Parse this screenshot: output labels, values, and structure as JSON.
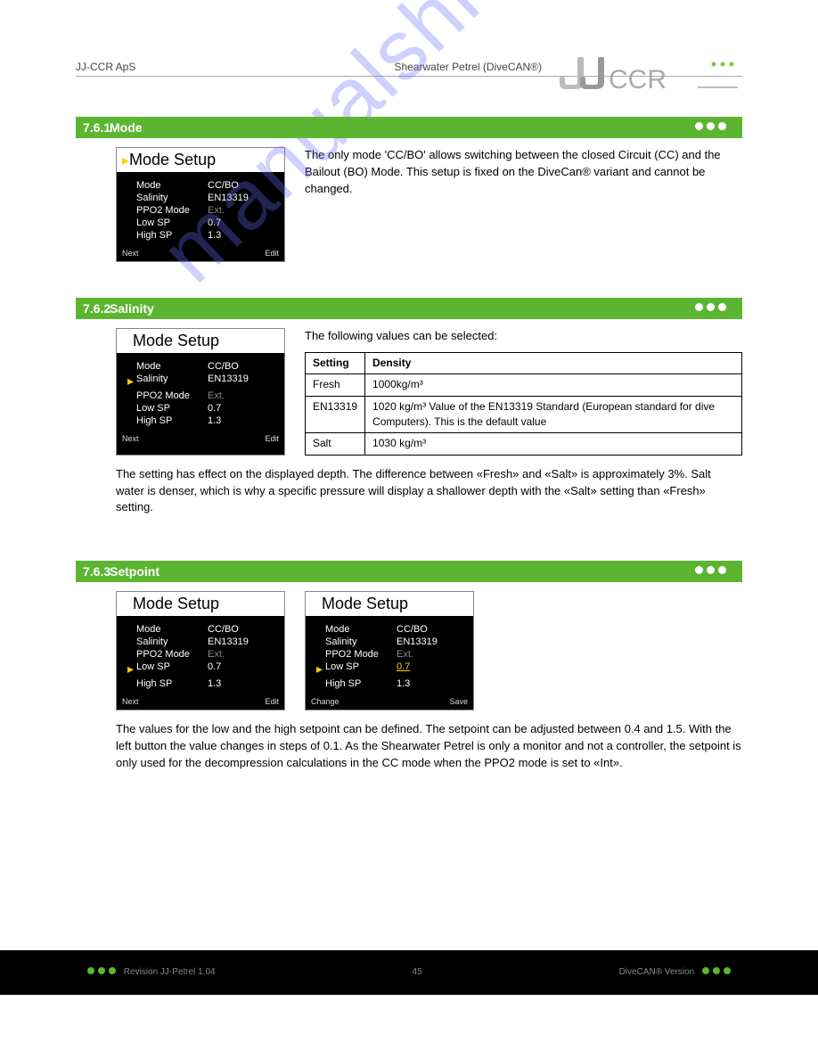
{
  "header": {
    "doc_title_left": "JJ-CCR ApS",
    "doc_title_right": "Shearwater Petrel (DiveCAN®)"
  },
  "logo": {
    "svg_name": "jjccr-logo"
  },
  "sections": [
    {
      "num": "7.6.1",
      "title": "Mode",
      "dots": true,
      "screenshot": {
        "title_arrow": true,
        "title": "Mode Setup",
        "rows": [
          {
            "sel": false,
            "label": "Mode",
            "value": "CC/BO"
          },
          {
            "sel": false,
            "label": "Salinity",
            "value": "EN13319"
          },
          {
            "sel": false,
            "label": "PPO2 Mode",
            "value": "Ext.",
            "grey": true
          },
          {
            "sel": false,
            "label": "Low SP",
            "value": "0.7"
          },
          {
            "sel": false,
            "label": "High SP",
            "value": "1.3"
          }
        ],
        "footer_left": "Next",
        "footer_right": "Edit"
      },
      "text": "The only mode 'CC/BO' allows switching between the closed Circuit (CC) and the Bailout (BO) Mode. This setup is fixed on the DiveCan® variant and cannot be changed."
    },
    {
      "num": "7.6.2",
      "title": "Salinity",
      "dots": true,
      "screenshot": {
        "title_arrow": false,
        "title": "Mode Setup",
        "rows": [
          {
            "sel": false,
            "label": "Mode",
            "value": "CC/BO"
          },
          {
            "sel": true,
            "label": "Salinity",
            "value": "EN13319"
          },
          {
            "sel": false,
            "label": "PPO2 Mode",
            "value": "Ext.",
            "grey": true
          },
          {
            "sel": false,
            "label": "Low SP",
            "value": "0.7"
          },
          {
            "sel": false,
            "label": "High SP",
            "value": "1.3"
          }
        ],
        "footer_left": "Next",
        "footer_right": "Edit"
      },
      "text_intro": "The following values can be selected:",
      "table": [
        {
          "setting": "Fresh",
          "density": "1000kg/m³"
        },
        {
          "setting": "EN13319",
          "density": "1020 kg/m³ Value of the EN13319 Standard (European standard for dive Computers). This is the default value"
        },
        {
          "setting": "Salt",
          "density": "1030 kg/m³"
        }
      ],
      "table_headers": {
        "col1": "Setting",
        "col2": "Density"
      },
      "text_after": "The setting has effect on the displayed depth. The difference between «Fresh» and «Salt» is approximately 3%. Salt water is denser, which is why a specific pressure will display a shallower depth with the «Salt» setting than «Fresh» setting."
    },
    {
      "num": "7.6.3",
      "title": "Setpoint",
      "dots": true,
      "screenshots": [
        {
          "title_arrow": false,
          "title": "Mode Setup",
          "rows": [
            {
              "sel": false,
              "label": "Mode",
              "value": "CC/BO"
            },
            {
              "sel": false,
              "label": "Salinity",
              "value": "EN13319"
            },
            {
              "sel": false,
              "label": "PPO2 Mode",
              "value": "Ext.",
              "grey": true
            },
            {
              "sel": true,
              "label": "Low SP",
              "value": "0.7"
            },
            {
              "sel": false,
              "label": "High SP",
              "value": "1.3"
            }
          ],
          "footer_left": "Next",
          "footer_right": "Edit"
        },
        {
          "title_arrow": false,
          "title": "Mode Setup",
          "rows": [
            {
              "sel": false,
              "label": "Mode",
              "value": "CC/BO"
            },
            {
              "sel": false,
              "label": "Salinity",
              "value": "EN13319"
            },
            {
              "sel": false,
              "label": "PPO2 Mode",
              "value": "Ext.",
              "grey": true
            },
            {
              "sel": true,
              "label": "Low SP",
              "value": "0.7",
              "underline": true
            },
            {
              "sel": false,
              "label": "High SP",
              "value": "1.3"
            }
          ],
          "footer_left": "Change",
          "footer_right": "Save"
        }
      ],
      "text_after": "The values for the low and the high setpoint can be defined. The setpoint can be adjusted between 0.4 and 1.5. With the left button the value changes in steps of 0.1. As the Shearwater Petrel is only a monitor and not a controller, the setpoint is only used for the decompression calculations in the CC mode when the PPO2 mode is set to «Int»."
    }
  ],
  "watermark": "manualshive.com",
  "footer": {
    "left_text": "Revision JJ-Petrel 1.04",
    "center_text": "45",
    "right_text": "DiveCAN® Version"
  }
}
